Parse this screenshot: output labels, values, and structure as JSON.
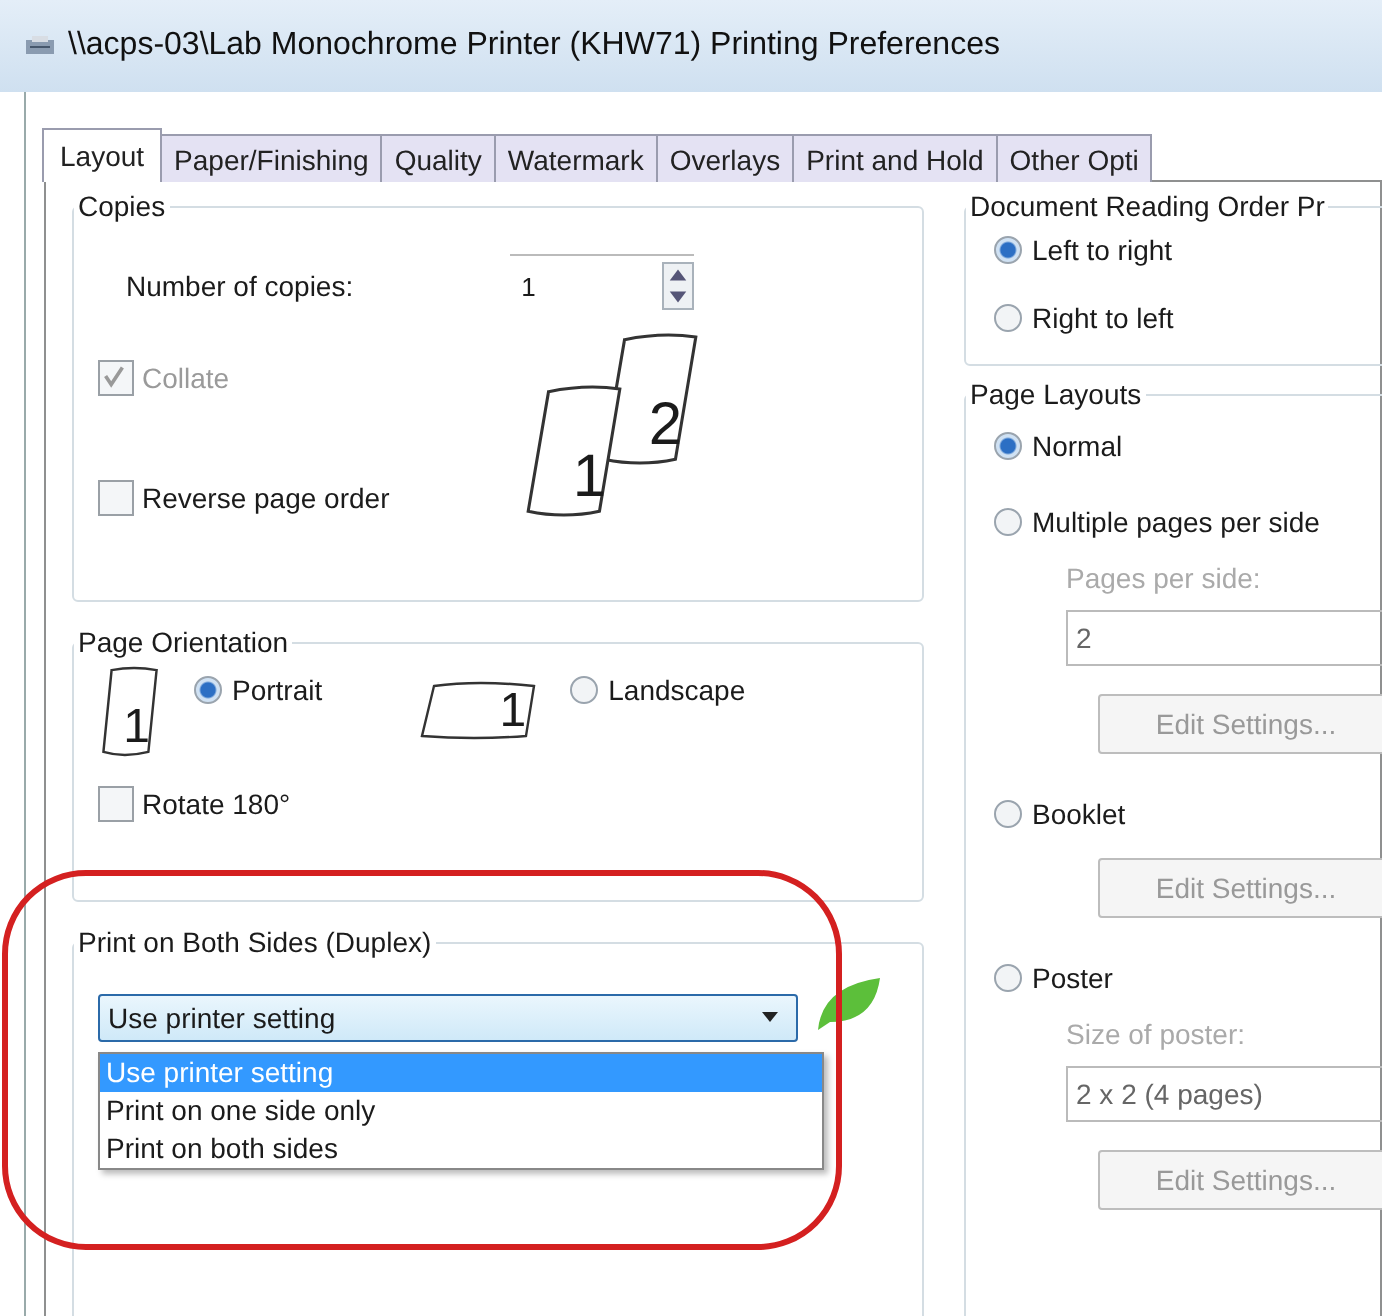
{
  "window": {
    "title": "\\\\acps-03\\Lab Monochrome Printer (KHW71) Printing Preferences"
  },
  "tabs": [
    {
      "label": "Layout",
      "selected": true
    },
    {
      "label": "Paper/Finishing",
      "selected": false
    },
    {
      "label": "Quality",
      "selected": false
    },
    {
      "label": "Watermark",
      "selected": false
    },
    {
      "label": "Overlays",
      "selected": false
    },
    {
      "label": "Print and Hold",
      "selected": false
    },
    {
      "label": "Other Opti",
      "selected": false
    }
  ],
  "copies": {
    "title": "Copies",
    "number_label": "Number of copies:",
    "number_value": "1",
    "collate": {
      "label": "Collate",
      "checked": true,
      "disabled": true
    },
    "reverse": {
      "label": "Reverse page order",
      "checked": false,
      "disabled": false
    },
    "preview_pages": [
      "2",
      "1"
    ]
  },
  "orientation": {
    "title": "Page Orientation",
    "options": [
      {
        "kind": "portrait",
        "label": "Portrait",
        "page_label": "1",
        "selected": true
      },
      {
        "kind": "landscape",
        "label": "Landscape",
        "page_label": "1",
        "selected": false
      }
    ],
    "rotate": {
      "label": "Rotate 180°",
      "checked": false,
      "disabled": false
    }
  },
  "duplex": {
    "title": "Print on Both Sides (Duplex)",
    "value": "Use printer setting",
    "expanded": true,
    "options": [
      {
        "label": "Use printer setting",
        "selected": true
      },
      {
        "label": "Print on one side only",
        "selected": false
      },
      {
        "label": "Print on both sides",
        "selected": false
      }
    ]
  },
  "reading_order": {
    "title": "Document Reading Order Pr",
    "options": [
      {
        "label": "Left to right",
        "selected": true
      },
      {
        "label": "Right to left",
        "selected": false
      }
    ]
  },
  "page_layouts": {
    "title": "Page Layouts",
    "items": [
      {
        "kind": "radio",
        "label": "Normal",
        "selected": true
      },
      {
        "kind": "radio",
        "label": "Multiple pages per side",
        "selected": false
      },
      {
        "kind": "caption",
        "text": "Pages per side:",
        "disabled": true
      },
      {
        "kind": "select",
        "value": "2",
        "disabled": true
      },
      {
        "kind": "button",
        "label": "Edit Settings...",
        "disabled": true
      },
      {
        "kind": "radio",
        "label": "Booklet",
        "selected": false
      },
      {
        "kind": "button",
        "label": "Edit Settings...",
        "disabled": true
      },
      {
        "kind": "radio",
        "label": "Poster",
        "selected": false
      },
      {
        "kind": "caption",
        "text": "Size of poster:",
        "disabled": true
      },
      {
        "kind": "select",
        "value": "2 x 2 (4 pages)",
        "disabled": true
      },
      {
        "kind": "button",
        "label": "Edit Settings...",
        "disabled": true
      }
    ]
  }
}
